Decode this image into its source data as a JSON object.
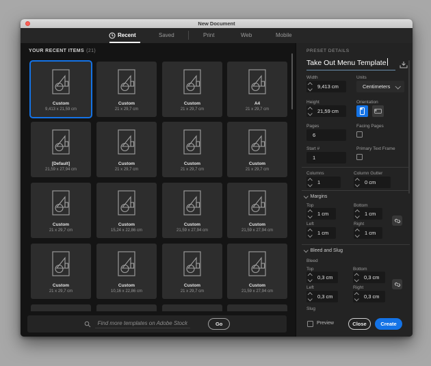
{
  "window": {
    "title": "New Document"
  },
  "tabs": [
    {
      "label": "Recent",
      "active": true
    },
    {
      "label": "Saved",
      "active": false
    },
    {
      "label": "Print",
      "active": false
    },
    {
      "label": "Web",
      "active": false
    },
    {
      "label": "Mobile",
      "active": false
    }
  ],
  "recent": {
    "heading": "YOUR RECENT ITEMS",
    "count": "(21)",
    "cards": [
      {
        "name": "Custom",
        "dims": "9,413 x 21,59 cm",
        "selected": true
      },
      {
        "name": "Custom",
        "dims": "21 x 29,7 cm",
        "selected": false
      },
      {
        "name": "Custom",
        "dims": "21 x 29,7 cm",
        "selected": false
      },
      {
        "name": "A4",
        "dims": "21 x 29,7 cm",
        "selected": false
      },
      {
        "name": "[Default]",
        "dims": "21,59 x 27,94 cm",
        "selected": false
      },
      {
        "name": "Custom",
        "dims": "21 x 29,7 cm",
        "selected": false
      },
      {
        "name": "Custom",
        "dims": "21 x 29,7 cm",
        "selected": false
      },
      {
        "name": "Custom",
        "dims": "21 x 29,7 cm",
        "selected": false
      },
      {
        "name": "Custom",
        "dims": "21 x 29,7 cm",
        "selected": false
      },
      {
        "name": "Custom",
        "dims": "15,24 x 22,86 cm",
        "selected": false
      },
      {
        "name": "Custom",
        "dims": "21,59 x 27,94 cm",
        "selected": false
      },
      {
        "name": "Custom",
        "dims": "21,59 x 27,94 cm",
        "selected": false
      },
      {
        "name": "Custom",
        "dims": "21 x 29,7 cm",
        "selected": false
      },
      {
        "name": "Custom",
        "dims": "10,16 x 22,86 cm",
        "selected": false
      },
      {
        "name": "Custom",
        "dims": "21 x 29,7 cm",
        "selected": false
      },
      {
        "name": "Custom",
        "dims": "21,59 x 27,94 cm",
        "selected": false
      }
    ]
  },
  "stock": {
    "placeholder": "Find more templates on Adobe Stock",
    "go_label": "Go"
  },
  "preset": {
    "heading": "PRESET DETAILS",
    "name_value": "Take Out Menu Template",
    "width_label": "Width",
    "width_value": "9,413 cm",
    "units_label": "Units",
    "units_value": "Centimeters",
    "height_label": "Height",
    "height_value": "21,59 cm",
    "orientation_label": "Orientation",
    "pages_label": "Pages",
    "pages_value": "6",
    "facing_label": "Facing Pages",
    "start_label": "Start #",
    "start_value": "1",
    "ptf_label": "Primary Text Frame",
    "columns_label": "Columns",
    "columns_value": "1",
    "gutter_label": "Column Gutter",
    "gutter_value": "0 cm",
    "margins": {
      "section_label": "Margins",
      "top_label": "Top",
      "top": "1 cm",
      "bottom_label": "Bottom",
      "bottom": "1 cm",
      "left_label": "Left",
      "left": "1 cm",
      "right_label": "Right",
      "right": "1 cm"
    },
    "bleed_slug": {
      "section_label": "Bleed and Slug",
      "bleed_label": "Bleed",
      "slug_label": "Slug",
      "top_label": "Top",
      "top": "0,3 cm",
      "bottom_label": "Bottom",
      "bottom": "0,3 cm",
      "left_label": "Left",
      "left": "0,3 cm",
      "right_label": "Right",
      "right": "0,3 cm"
    },
    "footer": {
      "preview_label": "Preview",
      "close_label": "Close",
      "create_label": "Create"
    }
  },
  "icons": [
    "close-window-icon",
    "clock-icon",
    "search-icon",
    "save-preset-icon",
    "chevron-up-icon",
    "chevron-down-icon",
    "portrait-orientation-icon",
    "landscape-orientation-icon",
    "link-chain-icon",
    "template-thumbnail-icon"
  ],
  "colors": {
    "accent": "#1473e6",
    "panel_bg": "#232323",
    "grid_bg": "#141414",
    "card_bg": "#2d2d2d",
    "tabbar_bg": "#262626"
  }
}
